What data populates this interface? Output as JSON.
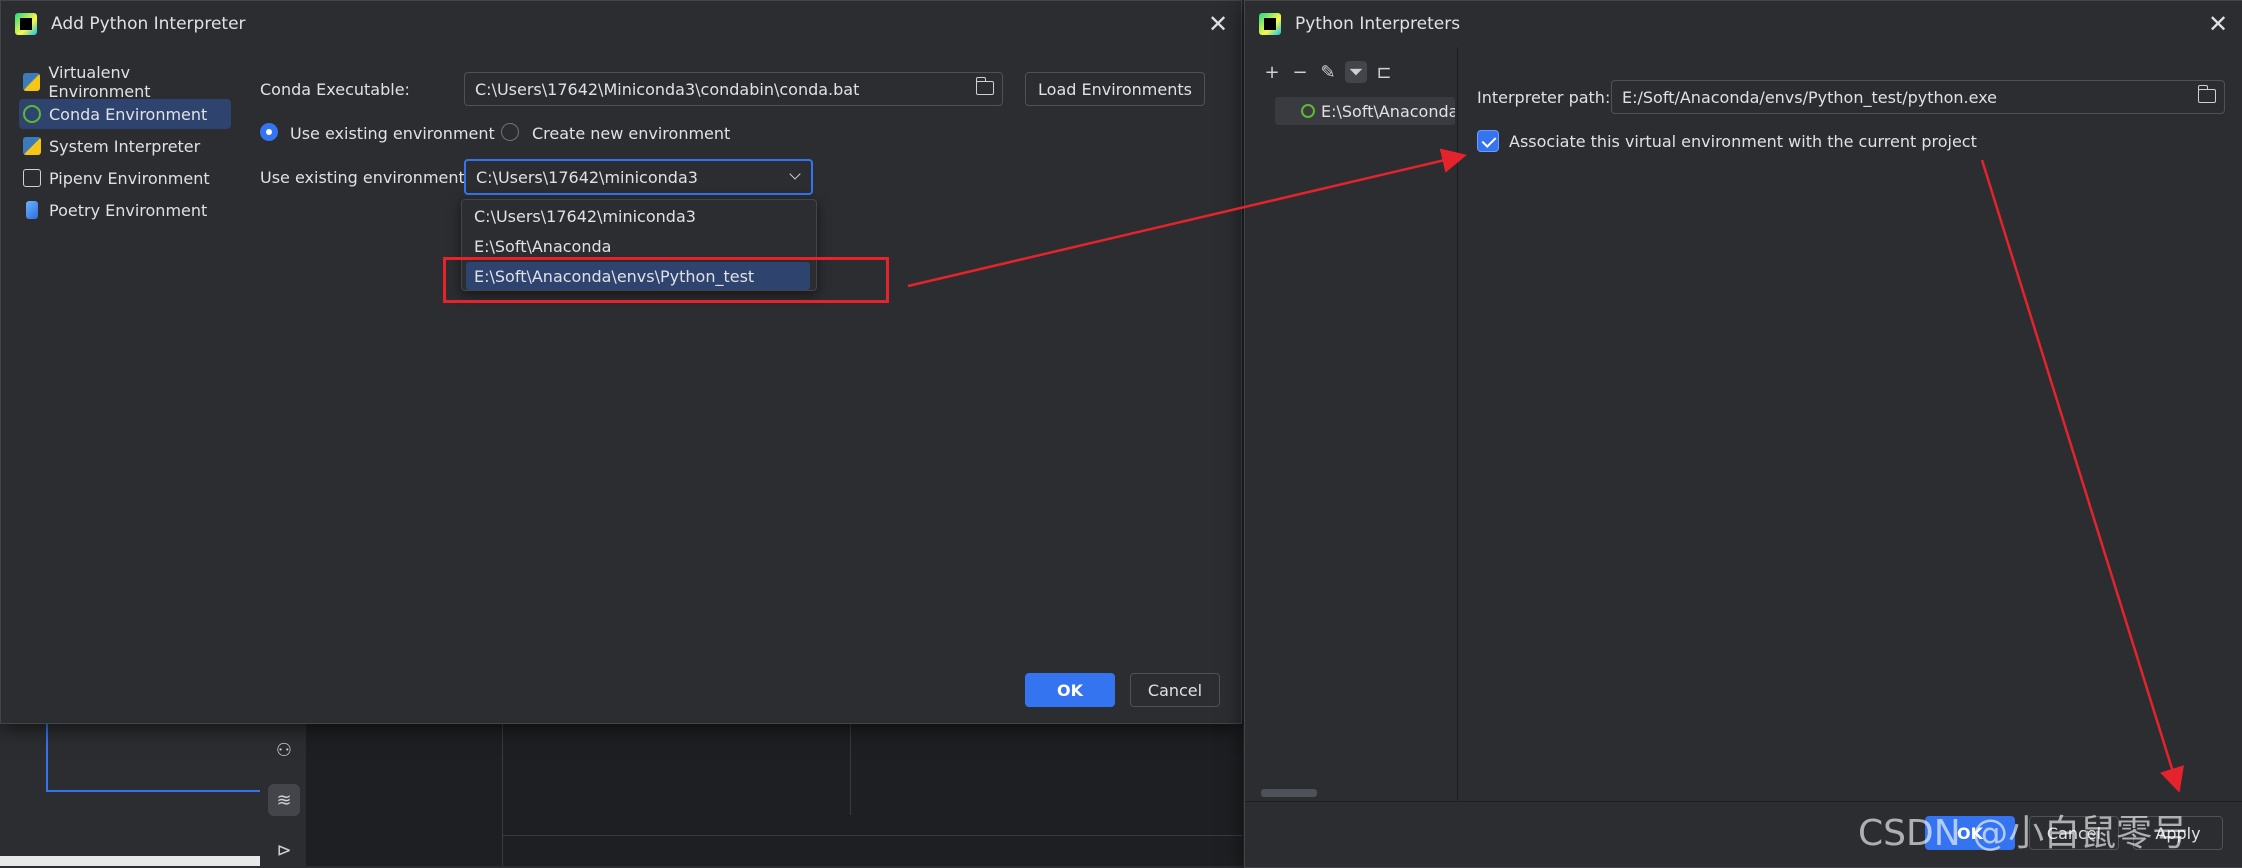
{
  "left_dialog": {
    "title": "Add Python Interpreter",
    "env_types": [
      {
        "label": "Virtualenv Environment",
        "icon": "python-icon",
        "selected": false
      },
      {
        "label": "Conda Environment",
        "icon": "conda-ring-icon",
        "selected": true
      },
      {
        "label": "System Interpreter",
        "icon": "python-icon",
        "selected": false
      },
      {
        "label": "Pipenv Environment",
        "icon": "pipenv-folder-icon",
        "selected": false
      },
      {
        "label": "Poetry Environment",
        "icon": "poetry-icon",
        "selected": false
      }
    ],
    "conda_exec_label": "Conda Executable:",
    "conda_exec_value": "C:\\Users\\17642\\Miniconda3\\condabin\\conda.bat",
    "load_button": "Load Environments",
    "radio_existing": "Use existing environment",
    "radio_new": "Create new environment",
    "existing_label": "Use existing environment:",
    "existing_value": "C:\\Users\\17642\\miniconda3",
    "dropdown_options": [
      "C:\\Users\\17642\\miniconda3",
      "E:\\Soft\\Anaconda",
      "E:\\Soft\\Anaconda\\envs\\Python_test"
    ],
    "ok": "OK",
    "cancel": "Cancel"
  },
  "right_dialog": {
    "title": "Python Interpreters",
    "interpreter_item": "E:\\Soft\\Anaconda",
    "path_label": "Interpreter path:",
    "path_value": "E:/Soft/Anaconda/envs/Python_test/python.exe",
    "associate_label": "Associate this virtual environment with the current project",
    "associate_checked": true,
    "ok": "OK",
    "cancel": "Cancel",
    "apply": "Apply"
  },
  "watermark": "CSDN @小白鼠零号",
  "colors": {
    "accent": "#3574f0",
    "highlight": "#e5232c",
    "bg": "#2b2d30"
  }
}
